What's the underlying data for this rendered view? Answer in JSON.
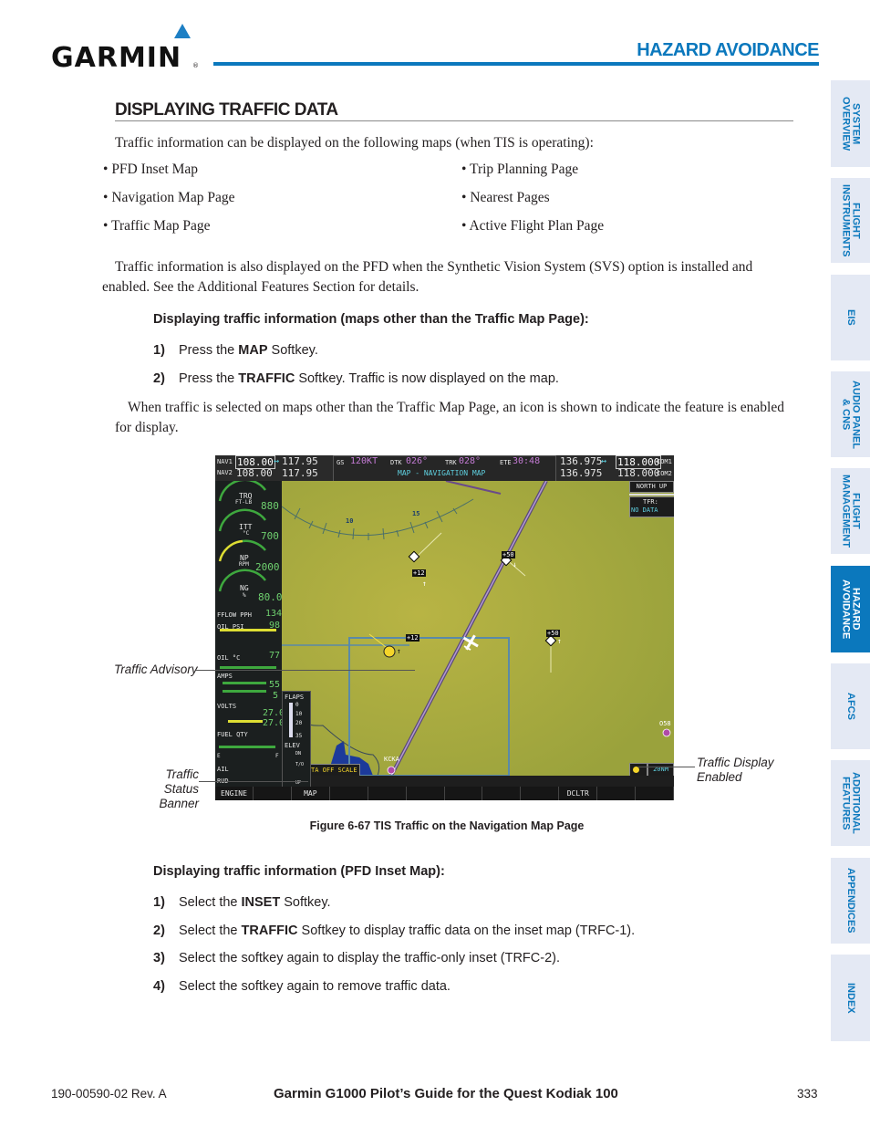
{
  "header": {
    "brand": "GARMIN",
    "section_title": "HAZARD AVOIDANCE"
  },
  "side_tabs": [
    {
      "label": "SYSTEM\nOVERVIEW",
      "active": false
    },
    {
      "label": "FLIGHT\nINSTRUMENTS",
      "active": false
    },
    {
      "label": "EIS",
      "active": false
    },
    {
      "label": "AUDIO PANEL\n& CNS",
      "active": false
    },
    {
      "label": "FLIGHT\nMANAGEMENT",
      "active": false
    },
    {
      "label": "HAZARD\nAVOIDANCE",
      "active": true
    },
    {
      "label": "AFCS",
      "active": false
    },
    {
      "label": "ADDITIONAL\nFEATURES",
      "active": false
    },
    {
      "label": "APPENDICES",
      "active": false
    },
    {
      "label": "INDEX",
      "active": false
    }
  ],
  "content": {
    "heading": "DISPLAYING TRAFFIC DATA",
    "intro": "Traffic information can be displayed on the following maps (when TIS is operating):",
    "maps_left": [
      "PFD Inset Map",
      "Navigation Map Page",
      "Traffic Map Page"
    ],
    "maps_right": [
      "Trip Planning Page",
      "Nearest Pages",
      "Active Flight Plan Page"
    ],
    "svs_note": "Traffic information is also displayed on the PFD when the Synthetic Vision System (SVS) option is installed and enabled.  See the Additional Features Section for details.",
    "proc1_title": "Displaying traffic information (maps other than the Traffic Map Page):",
    "proc1_steps": [
      {
        "num": "1)",
        "pre": "Press the ",
        "key": "MAP",
        "post": " Softkey."
      },
      {
        "num": "2)",
        "pre": "Press the ",
        "key": "TRAFFIC",
        "post": " Softkey.  Traffic is now displayed on the map."
      }
    ],
    "icon_note": "When traffic is selected on maps other than the Traffic Map Page, an icon is shown to indicate the feature is enabled for display.",
    "figure_caption": "Figure 6-67  TIS Traffic on the Navigation Map Page",
    "proc2_title": "Displaying traffic information (PFD Inset Map):",
    "proc2_steps": [
      {
        "num": "1)",
        "pre": "Select the ",
        "key": "INSET",
        "post": " Softkey."
      },
      {
        "num": "2)",
        "pre": "Select the ",
        "key": "TRAFFIC",
        "post": " Softkey to display traffic data on the inset map (TRFC-1)."
      },
      {
        "num": "3)",
        "pre": "Select the softkey again to display the traffic-only inset (TRFC-2).",
        "key": "",
        "post": ""
      },
      {
        "num": "4)",
        "pre": "Select the softkey again to remove traffic data.",
        "key": "",
        "post": ""
      }
    ]
  },
  "figure": {
    "callouts": {
      "traffic_advisory": "Traffic Advisory",
      "traffic_status_banner_1": "Traffic Status",
      "traffic_status_banner_2": "Banner",
      "traffic_display_enabled_1": "Traffic Display",
      "traffic_display_enabled_2": "Enabled"
    },
    "nav": {
      "nav1_label": "NAV1",
      "nav1_active": "108.00",
      "nav1_standby": "117.95",
      "nav2_label": "NAV2",
      "nav2_active": "108.00",
      "nav2_standby": "117.95",
      "swap": "↔"
    },
    "com": {
      "com1_label": "COM1",
      "com1_standby": "136.975",
      "com1_active": "118.000",
      "com2_label": "COM2",
      "com2_standby": "136.975",
      "com2_active": "118.000"
    },
    "data_bar": {
      "gs_label": "GS",
      "gs_value": "120KT",
      "dtk_label": "DTK",
      "dtk_value": "026°",
      "trk_label": "TRK",
      "trk_value": "028°",
      "ete_label": "ETE",
      "ete_value": "30:48",
      "page_title": "MAP - NAVIGATION MAP"
    },
    "map": {
      "orientation": "NORTH UP",
      "tfr_label": "TFR:",
      "tfr_status": "NO DATA",
      "arc_label_1": "10",
      "arc_label_2": "15",
      "range": "20NM",
      "status_banner": "TA OFF SCALE",
      "airport_1": "KCKA",
      "airport_2": "O58",
      "targets": [
        {
          "alt": "+12",
          "trend": "↑",
          "type": "other"
        },
        {
          "alt": "+50",
          "trend": "↓",
          "type": "other"
        },
        {
          "alt": "+50",
          "trend": "↑",
          "type": "other"
        },
        {
          "alt": "+12",
          "trend": "↑",
          "type": "advisory"
        }
      ]
    },
    "eis": {
      "trq_label": "TRQ",
      "trq_unit": "FT-LB",
      "trq_value": "880",
      "itt_label": "ITT",
      "itt_unit": "°C",
      "itt_value": "700",
      "np_label": "NP",
      "np_unit": "RPM",
      "np_value": "2000",
      "ng_label": "NG",
      "ng_unit": "%",
      "ng_value": "80.0",
      "fflow_label": "FFLOW PPH",
      "fflow_value": "134",
      "oil_psi_label": "OIL PSI",
      "oil_psi_value": "98",
      "oil_c_label": "OIL °C",
      "oil_c_value": "77",
      "amps_label": "AMPS",
      "amps_1": "55",
      "amps_2": "5",
      "volts_label": "VOLTS",
      "volts_1": "27.0",
      "volts_2": "27.0",
      "fuel_label": "FUEL QTY",
      "fuel_e": "E",
      "fuel_f": "F",
      "ail_label": "AIL",
      "rud_label": "RUD",
      "flaps_label": "FLAPS",
      "flaps_0": "0",
      "flaps_10": "10",
      "flaps_20": "20",
      "flaps_35": "35",
      "elev_label": "ELEV",
      "elev_dn": "DN",
      "elev_to": "T/O",
      "elev_up": "UP"
    },
    "softkeys": [
      "ENGINE",
      "",
      "MAP",
      "",
      "",
      "",
      "",
      "",
      "",
      "DCLTR",
      "",
      ""
    ]
  },
  "footer": {
    "doc_number": "190-00590-02  Rev. A",
    "title": "Garmin G1000 Pilot’s Guide for the Quest Kodiak 100",
    "page": "333"
  }
}
